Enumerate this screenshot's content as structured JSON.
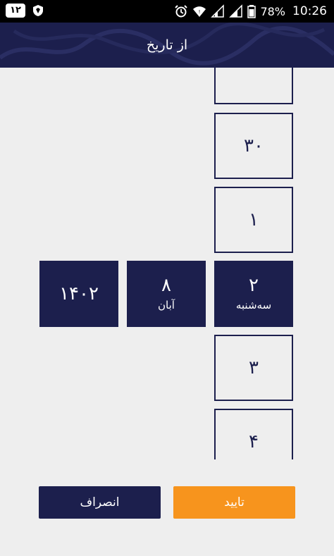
{
  "status_bar": {
    "badge": "۱۲",
    "battery": "78%",
    "time": "10:26",
    "icons": [
      "shield-icon",
      "alarm-clock-icon",
      "wifi-icon",
      "signal-icon",
      "signal-icon",
      "battery-icon"
    ]
  },
  "header": {
    "title": "از تاریخ"
  },
  "picker": {
    "day_column": [
      {
        "num": "۳۰",
        "sub": ""
      },
      {
        "num": "۱",
        "sub": ""
      },
      {
        "num": "۲",
        "sub": "سه‌شنبه"
      },
      {
        "num": "۳",
        "sub": ""
      },
      {
        "num": "۴",
        "sub": ""
      }
    ],
    "month": {
      "num": "۸",
      "sub": "آبان"
    },
    "year": {
      "num": "۱۴۰۲"
    }
  },
  "buttons": {
    "cancel": "انصراف",
    "confirm": "تایید"
  },
  "colors": {
    "primary": "#1c1f4d",
    "accent": "#f7941d",
    "background": "#eeeeee"
  }
}
